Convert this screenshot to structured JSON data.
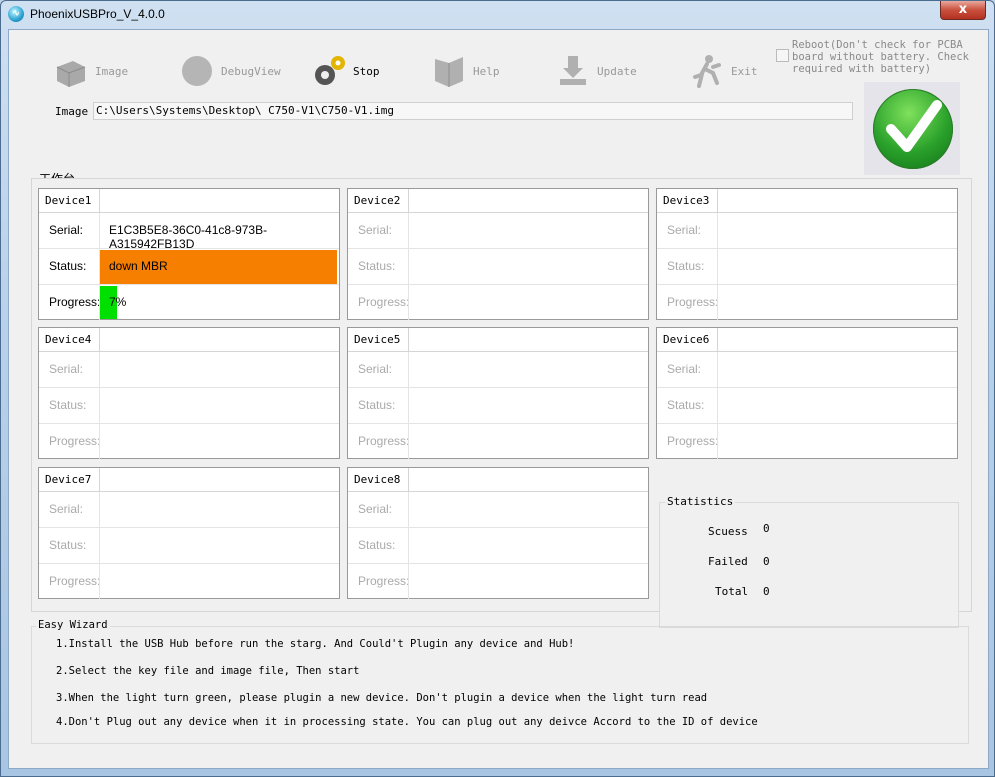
{
  "window": {
    "title": "PhoenixUSBPro_V_4.0.0",
    "close_label": "x"
  },
  "toolbar": {
    "image": "Image",
    "debugview": "DebugView",
    "stop": "Stop",
    "help": "Help",
    "update": "Update",
    "exit": "Exit",
    "reboot_text": "Reboot(Don't check for PCBA board without battery. Check required with battery)"
  },
  "image_field": {
    "label": "Image",
    "value": "C:\\Users\\Systems\\Desktop\\ C750-V1\\C750-V1.img"
  },
  "workspace": {
    "title": "工作台"
  },
  "labels": {
    "serial": "Serial:",
    "status": "Status:",
    "progress": "Progress:"
  },
  "devices": [
    {
      "name": "Device1",
      "serial": "E1C3B5E8-36C0-41c8-973B-A315942FB13D",
      "status": "down MBR",
      "progress": "7%",
      "progress_value": 0.07,
      "status_color": "#f77f00"
    },
    {
      "name": "Device2",
      "serial": "",
      "status": "",
      "progress": ""
    },
    {
      "name": "Device3",
      "serial": "",
      "status": "",
      "progress": ""
    },
    {
      "name": "Device4",
      "serial": "",
      "status": "",
      "progress": ""
    },
    {
      "name": "Device5",
      "serial": "",
      "status": "",
      "progress": ""
    },
    {
      "name": "Device6",
      "serial": "",
      "status": "",
      "progress": ""
    },
    {
      "name": "Device7",
      "serial": "",
      "status": "",
      "progress": ""
    },
    {
      "name": "Device8",
      "serial": "",
      "status": "",
      "progress": ""
    }
  ],
  "statistics": {
    "title": "Statistics",
    "success_label": "Scuess",
    "success_value": "0",
    "failed_label": "Failed",
    "failed_value": "0",
    "total_label": "Total",
    "total_value": "0"
  },
  "wizard": {
    "title": "Easy Wizard",
    "lines": [
      "1.Install the USB Hub before run the starg. And Could't Plugin any device and Hub!",
      "2.Select the key file and image file, Then start",
      "3.When the light turn green, please plugin a new device. Don't plugin a device when the light turn read",
      "4.Don't Plug out any device when it in processing state. You can plug out any deivce Accord to the ID of device"
    ]
  },
  "colors": {
    "ok_light": "#2aa12b",
    "status_busy": "#f77f00",
    "progress_bar": "#00e000"
  }
}
